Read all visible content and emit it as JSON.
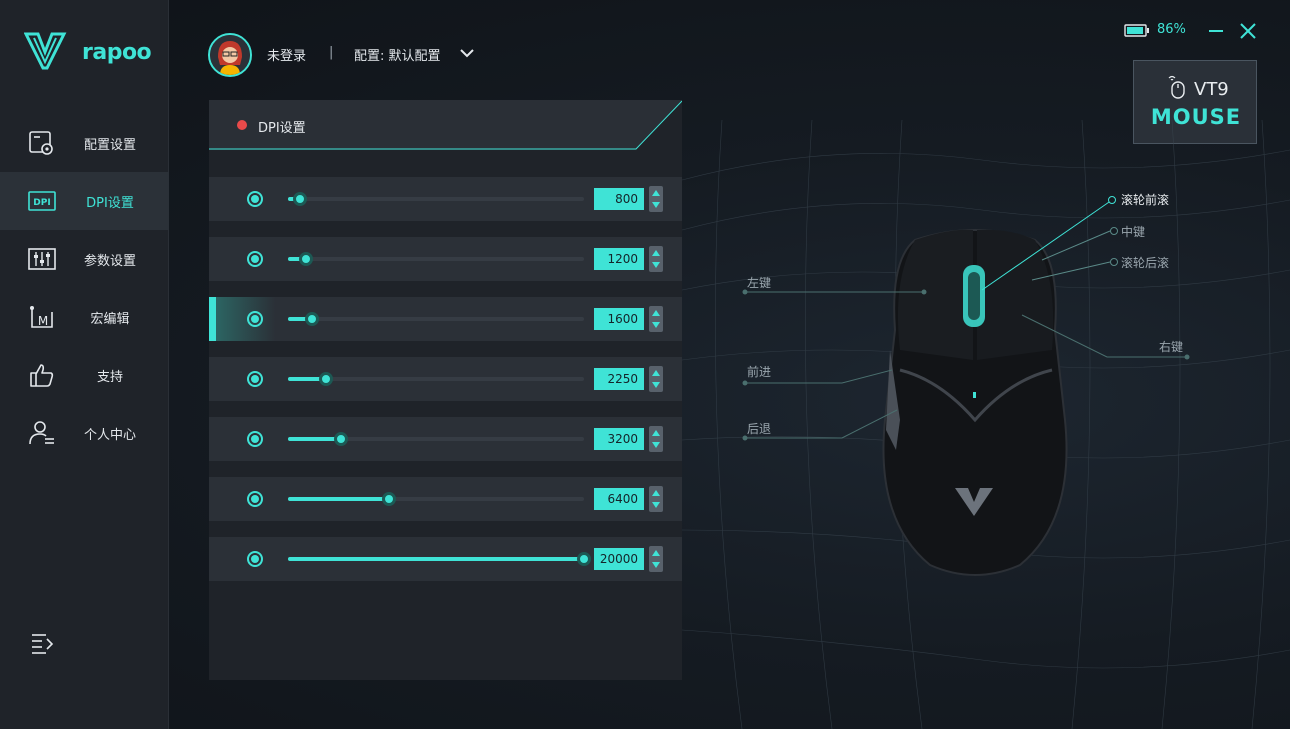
{
  "brand": {
    "logo_text": "rapoo"
  },
  "sidebar": {
    "items": [
      {
        "label": "配置设置",
        "icon": "profile-settings-icon"
      },
      {
        "label": "DPI设置",
        "icon": "dpi-icon",
        "active": true
      },
      {
        "label": "参数设置",
        "icon": "sliders-icon"
      },
      {
        "label": "宏编辑",
        "icon": "macro-icon"
      },
      {
        "label": "支持",
        "icon": "thumbs-up-icon"
      },
      {
        "label": "个人中心",
        "icon": "user-center-icon"
      }
    ]
  },
  "header": {
    "user_name": "未登录",
    "separator": "|",
    "config_label": "配置: 默认配置"
  },
  "status": {
    "battery": "86%"
  },
  "device": {
    "name": "VT9",
    "type": "MOUSE"
  },
  "dpi_panel": {
    "title": "DPI设置",
    "max_dpi": 20000,
    "levels": [
      {
        "value": "800",
        "fill": 0.04
      },
      {
        "value": "1200",
        "fill": 0.06
      },
      {
        "value": "1600",
        "fill": 0.08,
        "active": true
      },
      {
        "value": "2250",
        "fill": 0.13
      },
      {
        "value": "3200",
        "fill": 0.18
      },
      {
        "value": "6400",
        "fill": 0.34
      },
      {
        "value": "20000",
        "fill": 1.0
      }
    ]
  },
  "mouse_labels": {
    "scroll_up": "滚轮前滚",
    "middle": "中键",
    "scroll_down": "滚轮后滚",
    "left": "左键",
    "right": "右键",
    "forward": "前进",
    "back": "后退"
  },
  "colors": {
    "accent": "#3fe3d6",
    "panel": "#1f2329",
    "row": "#2b3037",
    "record_dot": "#e84a4a"
  }
}
